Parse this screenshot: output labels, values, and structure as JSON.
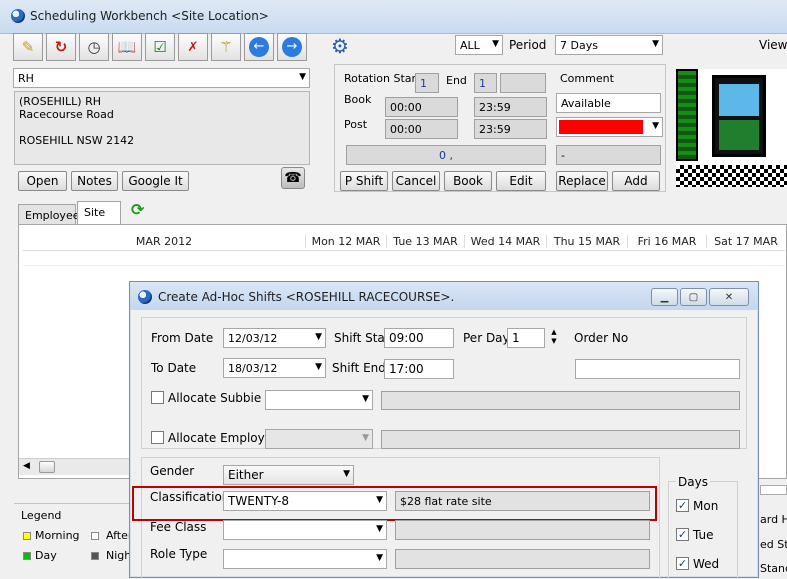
{
  "main": {
    "title": "Scheduling Workbench <Site Location>",
    "filter_value": "ALL",
    "period_label": "Period",
    "period_value": "7 Days",
    "view_label": "View"
  },
  "site": {
    "selector_value": "RH",
    "address_lines": [
      "(ROSEHILL) RH",
      "Racecourse Road",
      "",
      "ROSEHILL NSW 2142"
    ],
    "buttons": {
      "open": "Open",
      "notes": "Notes",
      "google": "Google It"
    }
  },
  "rotation": {
    "start_label": "Rotation Start",
    "start_value": "1",
    "end_label": "End",
    "end_value": "1",
    "book_label": "Book",
    "book_from": "00:00",
    "book_to": "23:59",
    "post_label": "Post",
    "post_from": "00:00",
    "post_to": "23:59",
    "info_value": "0 ,",
    "comment_label": "Comment",
    "comment_value": "Available",
    "color_swatch": "#ff0000",
    "dash_value": "-"
  },
  "action_buttons": {
    "p_shift": "P Shift",
    "cancel": "Cancel",
    "book": "Book",
    "edit": "Edit",
    "replace": "Replace",
    "add": "Add"
  },
  "tabs": {
    "employee": "Employee",
    "site": "Site"
  },
  "calendar": {
    "month_header": "MAR 2012",
    "days": [
      "Mon 12 MAR",
      "Tue 13 MAR",
      "Wed 14 MAR",
      "Thu 15 MAR",
      "Fri 16 MAR",
      "Sat 17 MAR"
    ]
  },
  "legend": {
    "title": "Legend",
    "morning": "Morning",
    "day": "Day",
    "after_partial": "After",
    "night_partial": "Nigh",
    "morning_color": "#ffff00",
    "day_color": "#00c000"
  },
  "right_partial": {
    "a": "ard H",
    "b": "ed Sto",
    "c": "Stand"
  },
  "dialog": {
    "title": "Create Ad-Hoc Shifts <ROSEHILL RACECOURSE>.",
    "from_date_label": "From Date",
    "from_date_value": "12/03/12",
    "to_date_label": "To Date",
    "to_date_value": "18/03/12",
    "shift_start_label": "Shift Start",
    "shift_start_value": "09:00",
    "shift_end_label": "Shift End",
    "shift_end_value": "17:00",
    "per_day_label": "Per Day",
    "per_day_value": "1",
    "order_no_label": "Order No",
    "allocate_subbie_label": "Allocate Subbie",
    "allocate_employee_label": "Allocate Employee",
    "gender_label": "Gender",
    "gender_value": "Either",
    "classification_label": "Classification",
    "classification_value": "TWENTY-8",
    "classification_desc": "$28 flat rate site",
    "fee_class_label": "Fee Class",
    "role_type_label": "Role Type",
    "days_label": "Days",
    "days": [
      "Mon",
      "Tue",
      "Wed"
    ],
    "highlight_color": "#c00000"
  }
}
